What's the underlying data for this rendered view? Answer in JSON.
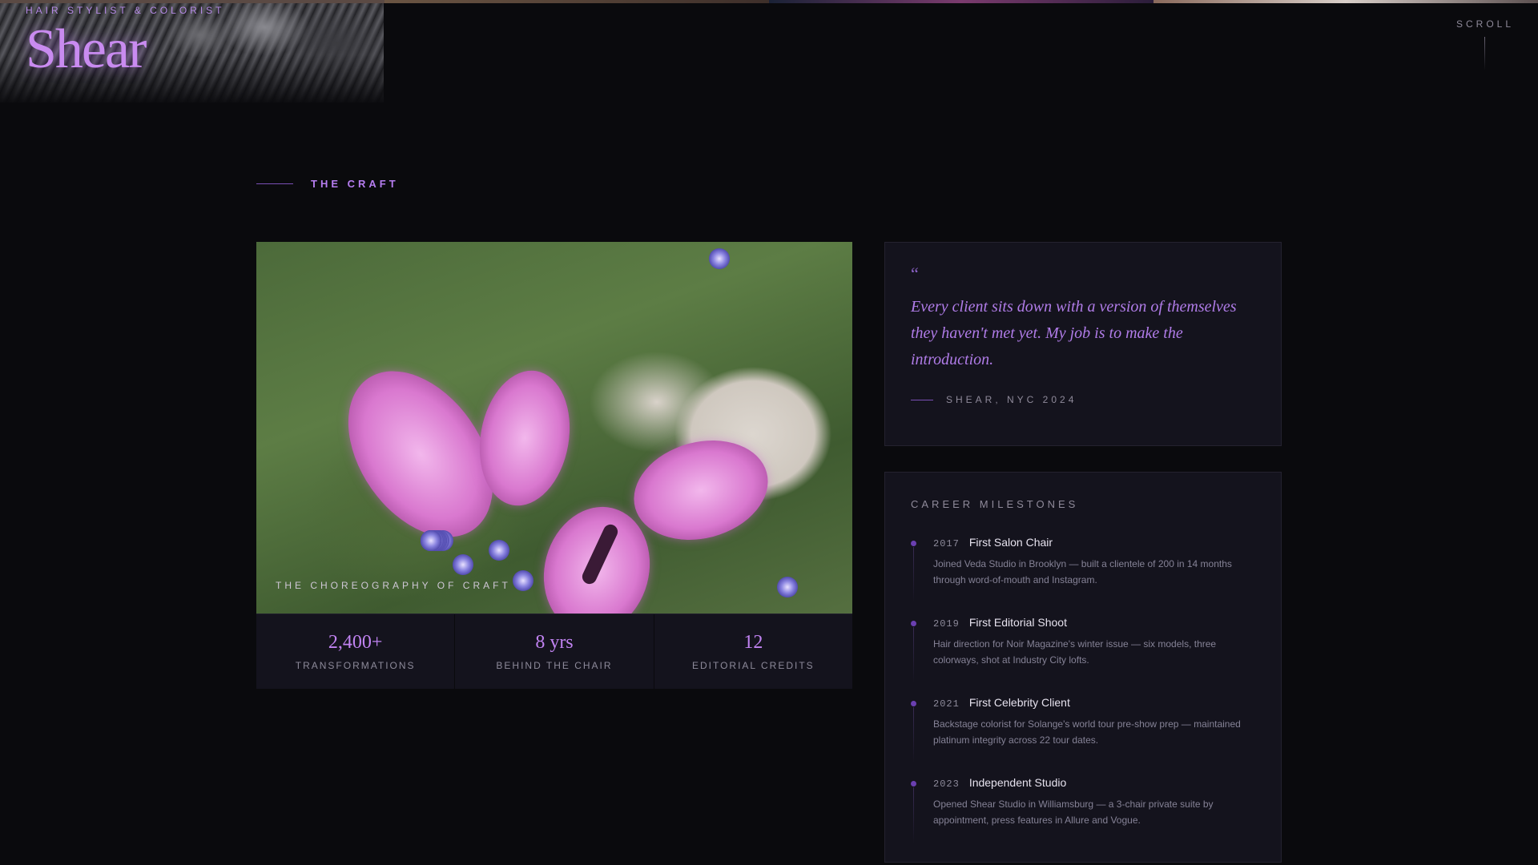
{
  "hero": {
    "eyebrow": "HAIR STYLIST & COLORIST",
    "title": "Shear"
  },
  "scroll": {
    "label": "SCROLL"
  },
  "section": {
    "label": "THE CRAFT"
  },
  "feature": {
    "caption": "THE CHOREOGRAPHY OF CRAFT"
  },
  "stats": [
    {
      "value": "2,400+",
      "label": "TRANSFORMATIONS"
    },
    {
      "value": "8 yrs",
      "label": "BEHIND THE CHAIR"
    },
    {
      "value": "12",
      "label": "EDITORIAL CREDITS"
    }
  ],
  "quote": {
    "mark": "“",
    "text": "Every client sits down with a version of themselves they haven't met yet. My job is to make the introduction.",
    "signature": "SHEAR, NYC 2024"
  },
  "milestones": {
    "title": "CAREER MILESTONES",
    "items": [
      {
        "year": "2017",
        "title": "First Salon Chair",
        "desc": "Joined Veda Studio in Brooklyn — built a clientele of 200 in 14 months through word-of-mouth and Instagram."
      },
      {
        "year": "2019",
        "title": "First Editorial Shoot",
        "desc": "Hair direction for Noir Magazine's winter issue — six models, three colorways, shot at Industry City lofts."
      },
      {
        "year": "2021",
        "title": "First Celebrity Client",
        "desc": "Backstage colorist for Solange's world tour pre-show prep — maintained platinum integrity across 22 tour dates."
      },
      {
        "year": "2023",
        "title": "Independent Studio",
        "desc": "Opened Shear Studio in Williamsburg — a 3-chair private suite by appointment, press features in Allure and Vogue."
      }
    ]
  },
  "colors": {
    "accent": "#c183f2",
    "background": "#0a0a0d",
    "card": "#14131d"
  }
}
